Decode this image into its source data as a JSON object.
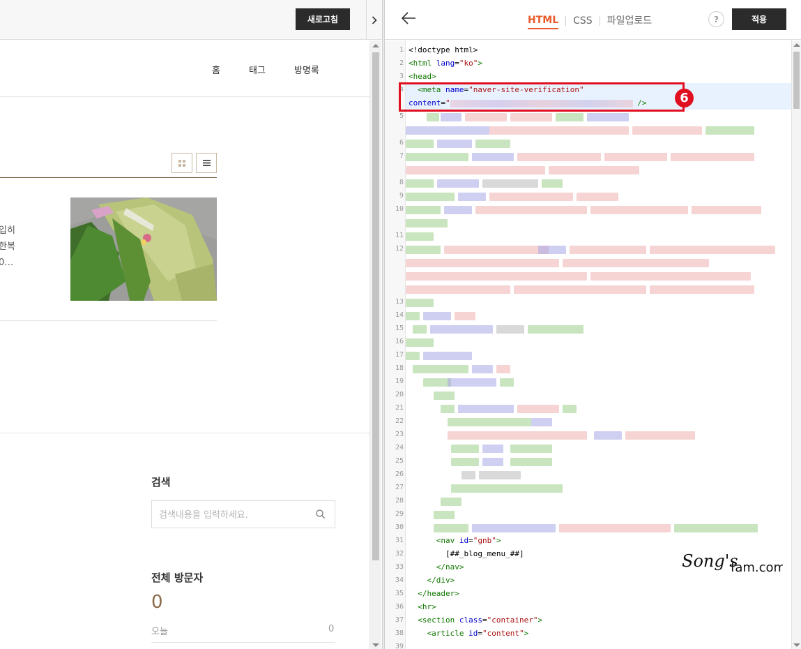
{
  "preview": {
    "refresh_label": "새로고침",
    "collapse_icon": "chevron-right-icon",
    "nav": [
      "홈",
      "태그",
      "방명록"
    ],
    "post_excerpt_lines": [
      "입히",
      "한복",
      "0…"
    ],
    "search": {
      "title": "검색",
      "placeholder": "검색내용을 입력하세요."
    },
    "visitors": {
      "title": "전체 방문자",
      "total": "0",
      "today_label": "오늘",
      "today_value": "0"
    }
  },
  "editor": {
    "back_icon": "arrow-left-icon",
    "tabs": [
      "HTML",
      "CSS",
      "파일업로드"
    ],
    "active_tab": "HTML",
    "help_label": "?",
    "apply_label": "적용",
    "step_badge": "6",
    "line_numbers": [
      "1",
      "2",
      "3",
      "4",
      "5",
      "6",
      "7",
      "8",
      "9",
      "10",
      "11",
      "12",
      "13",
      "14",
      "15",
      "16",
      "17",
      "18",
      "19",
      "20",
      "21",
      "22",
      "23",
      "24",
      "25",
      "26",
      "27",
      "28",
      "29",
      "30",
      "31",
      "32",
      "33",
      "34",
      "35",
      "36",
      "37",
      "38",
      "39"
    ],
    "code": {
      "l1": "<!doctype html>",
      "l2a": "<html ",
      "l2b": "lang",
      "l2c": "=",
      "l2d": "\"ko\"",
      "l2e": ">",
      "l3": "<head>",
      "l4a": "  <meta ",
      "l4b": "name",
      "l4c": "=",
      "l4d": "\"naver-site-verification\"",
      "l4e": "content",
      "l4f": "=",
      "l4g": "\"",
      "l4h": " />",
      "l31a": "      <nav ",
      "l31b": "id",
      "l31c": "=",
      "l31d": "\"gnb\"",
      "l31e": ">",
      "l32": "        [##_blog_menu_##]",
      "l33": "      </nav>",
      "l34": "    </div>",
      "l35": "  </header>",
      "l36": "  <hr>",
      "l37a": "  <section ",
      "l37b": "class",
      "l37c": "=",
      "l37d": "\"container\"",
      "l37e": ">",
      "l38a": "    <article ",
      "l38b": "id",
      "l38c": "=",
      "l38d": "\"content\"",
      "l38e": ">"
    },
    "blur_colors": [
      "#9ccf8a",
      "#a7a7e8",
      "#f0b0b0",
      "#b9b9b9"
    ]
  },
  "watermark": {
    "script_text": "Song's",
    "domain_text": "fam.com"
  },
  "colors": {
    "accent_tab": "#e85a2a",
    "highlight_red": "#e01020",
    "dark_button": "#2b2b2b",
    "brand_brown": "#8a6a4a"
  }
}
